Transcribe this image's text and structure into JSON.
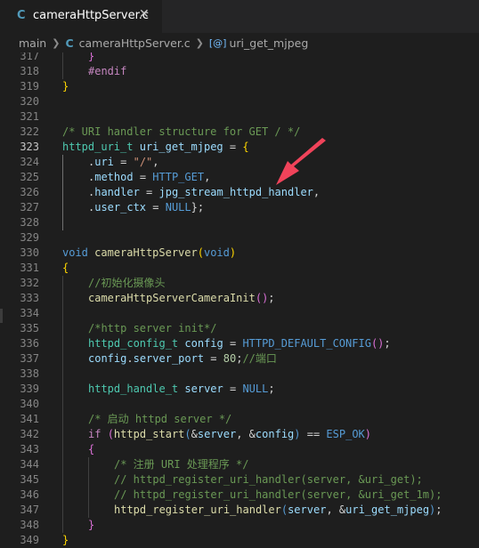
{
  "tab": {
    "icon_letter": "C",
    "filename": "cameraHttpServer.c",
    "close_glyph": "✕"
  },
  "breadcrumb": {
    "folder": "main",
    "file_icon_letter": "C",
    "file": "cameraHttpServer.c",
    "symbol_icon": "[@]",
    "symbol": "uri_get_mjpeg"
  },
  "editor": {
    "active_line": "323",
    "lines": [
      {
        "n": "317",
        "tokens": [
          {
            "t": "}",
            "c": "brace2"
          }
        ]
      },
      {
        "n": "318",
        "tokens": [
          {
            "t": "#endif",
            "c": "kw2"
          }
        ]
      },
      {
        "n": "319",
        "tokens": [
          {
            "t": "}",
            "c": "brace"
          }
        ]
      },
      {
        "n": "320",
        "tokens": []
      },
      {
        "n": "321",
        "tokens": []
      },
      {
        "n": "322",
        "tokens": [
          {
            "t": "/* URI handler structure for GET / */",
            "c": "com"
          }
        ]
      },
      {
        "n": "323",
        "tokens": [
          {
            "t": "httpd_uri_t",
            "c": "ty"
          },
          {
            "t": " ",
            "c": "punc"
          },
          {
            "t": "uri_get_mjpeg",
            "c": "var"
          },
          {
            "t": " = ",
            "c": "punc"
          },
          {
            "t": "{",
            "c": "brace"
          }
        ]
      },
      {
        "n": "324",
        "tokens": [
          {
            "t": ".",
            "c": "punc"
          },
          {
            "t": "uri",
            "c": "var"
          },
          {
            "t": " = ",
            "c": "punc"
          },
          {
            "t": "\"/\"",
            "c": "str"
          },
          {
            "t": ",",
            "c": "punc"
          }
        ]
      },
      {
        "n": "325",
        "tokens": [
          {
            "t": ".",
            "c": "punc"
          },
          {
            "t": "method",
            "c": "var"
          },
          {
            "t": " = ",
            "c": "punc"
          },
          {
            "t": "HTTP_GET",
            "c": "mac"
          },
          {
            "t": ",",
            "c": "punc"
          }
        ]
      },
      {
        "n": "326",
        "tokens": [
          {
            "t": ".",
            "c": "punc"
          },
          {
            "t": "handler",
            "c": "var"
          },
          {
            "t": " = ",
            "c": "punc"
          },
          {
            "t": "jpg_stream_httpd_handler",
            "c": "var"
          },
          {
            "t": ",",
            "c": "punc"
          }
        ]
      },
      {
        "n": "327",
        "tokens": [
          {
            "t": ".",
            "c": "punc"
          },
          {
            "t": "user_ctx",
            "c": "var"
          },
          {
            "t": " = ",
            "c": "punc"
          },
          {
            "t": "NULL",
            "c": "mac"
          },
          {
            "t": "};",
            "c": "punc"
          }
        ]
      },
      {
        "n": "328",
        "tokens": []
      },
      {
        "n": "329",
        "tokens": []
      },
      {
        "n": "330",
        "tokens": [
          {
            "t": "void",
            "c": "kw"
          },
          {
            "t": " ",
            "c": "punc"
          },
          {
            "t": "cameraHttpServer",
            "c": "fn"
          },
          {
            "t": "(",
            "c": "brace"
          },
          {
            "t": "void",
            "c": "kw"
          },
          {
            "t": ")",
            "c": "brace"
          }
        ]
      },
      {
        "n": "331",
        "tokens": [
          {
            "t": "{",
            "c": "brace"
          }
        ]
      },
      {
        "n": "332",
        "tokens": [
          {
            "t": "//初始化摄像头",
            "c": "com"
          }
        ]
      },
      {
        "n": "333",
        "tokens": [
          {
            "t": "cameraHttpServerCameraInit",
            "c": "fn"
          },
          {
            "t": "()",
            "c": "brace2"
          },
          {
            "t": ";",
            "c": "punc"
          }
        ]
      },
      {
        "n": "334",
        "tokens": []
      },
      {
        "n": "335",
        "tokens": [
          {
            "t": "/*http server init*/",
            "c": "com"
          }
        ]
      },
      {
        "n": "336",
        "tokens": [
          {
            "t": "httpd_config_t",
            "c": "ty"
          },
          {
            "t": " ",
            "c": "punc"
          },
          {
            "t": "config",
            "c": "var"
          },
          {
            "t": " = ",
            "c": "punc"
          },
          {
            "t": "HTTPD_DEFAULT_CONFIG",
            "c": "mac"
          },
          {
            "t": "()",
            "c": "brace2"
          },
          {
            "t": ";",
            "c": "punc"
          }
        ]
      },
      {
        "n": "337",
        "tokens": [
          {
            "t": "config",
            "c": "var"
          },
          {
            "t": ".",
            "c": "punc"
          },
          {
            "t": "server_port",
            "c": "var"
          },
          {
            "t": " = ",
            "c": "punc"
          },
          {
            "t": "80",
            "c": "num"
          },
          {
            "t": ";",
            "c": "punc"
          },
          {
            "t": "//端口",
            "c": "com"
          }
        ]
      },
      {
        "n": "338",
        "tokens": []
      },
      {
        "n": "339",
        "tokens": [
          {
            "t": "httpd_handle_t",
            "c": "ty"
          },
          {
            "t": " ",
            "c": "punc"
          },
          {
            "t": "server",
            "c": "var"
          },
          {
            "t": " = ",
            "c": "punc"
          },
          {
            "t": "NULL",
            "c": "mac"
          },
          {
            "t": ";",
            "c": "punc"
          }
        ]
      },
      {
        "n": "340",
        "tokens": []
      },
      {
        "n": "341",
        "tokens": [
          {
            "t": "/* 启动 httpd server */",
            "c": "com"
          }
        ]
      },
      {
        "n": "342",
        "tokens": [
          {
            "t": "if",
            "c": "kw2"
          },
          {
            "t": " ",
            "c": "punc"
          },
          {
            "t": "(",
            "c": "brace2"
          },
          {
            "t": "httpd_start",
            "c": "fn"
          },
          {
            "t": "(",
            "c": "kw"
          },
          {
            "t": "&",
            "c": "punc"
          },
          {
            "t": "server",
            "c": "var"
          },
          {
            "t": ", &",
            "c": "punc"
          },
          {
            "t": "config",
            "c": "var"
          },
          {
            "t": ")",
            "c": "kw"
          },
          {
            "t": " == ",
            "c": "punc"
          },
          {
            "t": "ESP_OK",
            "c": "mac"
          },
          {
            "t": ")",
            "c": "brace2"
          }
        ]
      },
      {
        "n": "343",
        "tokens": [
          {
            "t": "{",
            "c": "brace2"
          }
        ]
      },
      {
        "n": "344",
        "tokens": [
          {
            "t": "/* 注册 URI 处理程序 */",
            "c": "com"
          }
        ]
      },
      {
        "n": "345",
        "tokens": [
          {
            "t": "// httpd_register_uri_handler(server, &uri_get);",
            "c": "com"
          }
        ]
      },
      {
        "n": "346",
        "tokens": [
          {
            "t": "// httpd_register_uri_handler(server, &uri_get_1m);",
            "c": "com"
          }
        ]
      },
      {
        "n": "347",
        "tokens": [
          {
            "t": "httpd_register_uri_handler",
            "c": "fn"
          },
          {
            "t": "(",
            "c": "kw"
          },
          {
            "t": "server",
            "c": "var"
          },
          {
            "t": ", &",
            "c": "punc"
          },
          {
            "t": "uri_get_mjpeg",
            "c": "var"
          },
          {
            "t": ")",
            "c": "kw"
          },
          {
            "t": ";",
            "c": "punc"
          }
        ]
      },
      {
        "n": "348",
        "tokens": [
          {
            "t": "}",
            "c": "brace2"
          }
        ]
      },
      {
        "n": "349",
        "tokens": [
          {
            "t": "}",
            "c": "brace"
          }
        ]
      }
    ]
  },
  "annotation": {
    "arrow_color": "#f0435a"
  }
}
